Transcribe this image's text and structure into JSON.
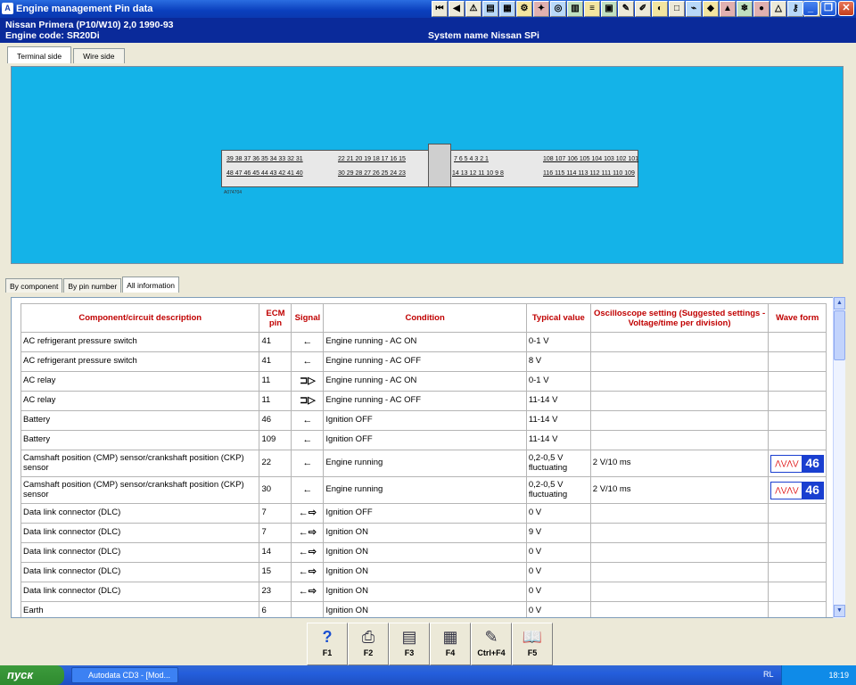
{
  "window": {
    "title": "Engine management Pin data"
  },
  "vehicle": {
    "model": "Nissan   Primera (P10/W10) 2,0  1990-93",
    "engine_code": "Engine code: SR20Di",
    "system_name": "System name Nissan SPi"
  },
  "view_tabs": [
    {
      "label": "Terminal side"
    },
    {
      "label": "Wire side"
    }
  ],
  "connector": {
    "top_left": "39 38 37 36 35 34 33 32 31",
    "top_mid": "22 21 20 19 18 17 16 15",
    "top_right": "7 6 5 4 3 2 1",
    "top_far": "108 107 106 105 104 103 102 101",
    "bot_left": "48 47 46 45 44 43 42 41 40",
    "bot_mid": "30 29 28 27 26 25 24 23",
    "bot_right": "14 13 12 11 10 9 8",
    "bot_far": "116 115 114 113 112 111 110 109",
    "label": "A074704"
  },
  "info_tabs": [
    {
      "label": "By component"
    },
    {
      "label": "By pin number"
    },
    {
      "label": "All information"
    }
  ],
  "table": {
    "headers": {
      "description": "Component/circuit description",
      "ecm_pin": "ECM pin",
      "signal": "Signal",
      "condition": "Condition",
      "typical": "Typical value",
      "scope": "Oscilloscope setting (Suggested settings - Voltage/time per division)",
      "wave": "Wave form"
    },
    "rows": [
      {
        "description": "AC refrigerant pressure switch",
        "pin": "41",
        "signal": "←",
        "condition": "Engine running - AC ON",
        "typical": "0-1 V",
        "scope": "",
        "wave": ""
      },
      {
        "description": "AC refrigerant pressure switch",
        "pin": "41",
        "signal": "←",
        "condition": "Engine running - AC OFF",
        "typical": "8 V",
        "scope": "",
        "wave": ""
      },
      {
        "description": "AC relay",
        "pin": "11",
        "signal": "⊐▷",
        "condition": "Engine running - AC ON",
        "typical": "0-1 V",
        "scope": "",
        "wave": ""
      },
      {
        "description": "AC relay",
        "pin": "11",
        "signal": "⊐▷",
        "condition": "Engine running - AC OFF",
        "typical": "11-14 V",
        "scope": "",
        "wave": ""
      },
      {
        "description": "Battery",
        "pin": "46",
        "signal": "←",
        "condition": "Ignition OFF",
        "typical": "11-14 V",
        "scope": "",
        "wave": ""
      },
      {
        "description": "Battery",
        "pin": "109",
        "signal": "←",
        "condition": "Ignition OFF",
        "typical": "11-14 V",
        "scope": "",
        "wave": ""
      },
      {
        "description": "Camshaft position (CMP) sensor/crankshaft position (CKP) sensor",
        "pin": "22",
        "signal": "←",
        "condition": "Engine running",
        "typical": "0,2-0,5 V fluctuating",
        "scope": "2 V/10 ms",
        "wave": "46"
      },
      {
        "description": "Camshaft position (CMP) sensor/crankshaft position (CKP) sensor",
        "pin": "30",
        "signal": "←",
        "condition": "Engine running",
        "typical": "0,2-0,5 V fluctuating",
        "scope": "2 V/10 ms",
        "wave": "46"
      },
      {
        "description": "Data link connector (DLC)",
        "pin": "7",
        "signal": "←⇨",
        "condition": "Ignition OFF",
        "typical": "0 V",
        "scope": "",
        "wave": ""
      },
      {
        "description": "Data link connector (DLC)",
        "pin": "7",
        "signal": "←⇨",
        "condition": "Ignition ON",
        "typical": "9 V",
        "scope": "",
        "wave": ""
      },
      {
        "description": "Data link connector (DLC)",
        "pin": "14",
        "signal": "←⇨",
        "condition": "Ignition ON",
        "typical": "0 V",
        "scope": "",
        "wave": ""
      },
      {
        "description": "Data link connector (DLC)",
        "pin": "15",
        "signal": "←⇨",
        "condition": "Ignition ON",
        "typical": "0 V",
        "scope": "",
        "wave": ""
      },
      {
        "description": "Data link connector (DLC)",
        "pin": "23",
        "signal": "←⇨",
        "condition": "Ignition ON",
        "typical": "0 V",
        "scope": "",
        "wave": ""
      },
      {
        "description": "Earth",
        "pin": "6",
        "signal": "",
        "condition": "Ignition ON",
        "typical": "0 V",
        "scope": "",
        "wave": ""
      }
    ]
  },
  "function_keys": [
    {
      "label": "F1",
      "icon": "help-icon"
    },
    {
      "label": "F2",
      "icon": "print-icon"
    },
    {
      "label": "F3",
      "icon": "print-preview-icon"
    },
    {
      "label": "F4",
      "icon": "print-page-icon"
    },
    {
      "label": "Ctrl+F4",
      "icon": "notes-icon"
    },
    {
      "label": "F5",
      "icon": "book-icon"
    }
  ],
  "taskbar": {
    "start": "пуск",
    "task": "Autodata CD3 - [Mod...",
    "lang": "RL",
    "clock": "18:19"
  }
}
